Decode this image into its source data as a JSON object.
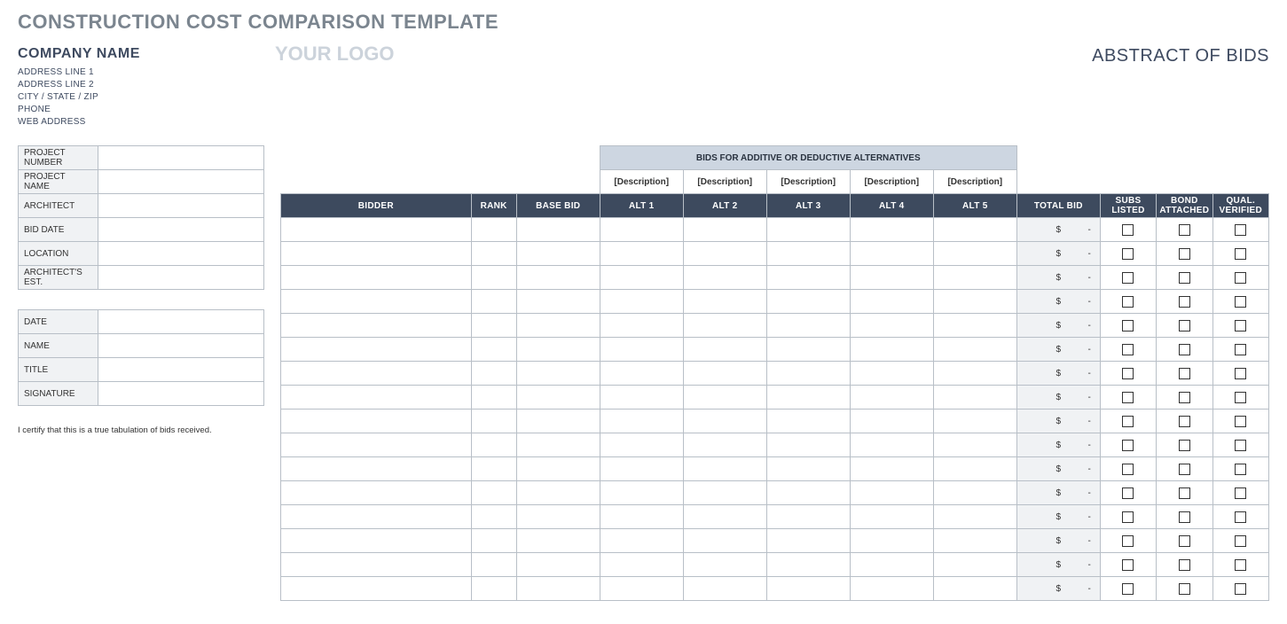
{
  "title": "CONSTRUCTION COST COMPARISON TEMPLATE",
  "company": {
    "name": "COMPANY NAME",
    "addr1": "ADDRESS LINE 1",
    "addr2": "ADDRESS LINE 2",
    "csz": "CITY / STATE / ZIP",
    "phone": "PHONE",
    "web": "WEB ADDRESS"
  },
  "logo": "YOUR LOGO",
  "abstract": "ABSTRACT OF BIDS",
  "infoLabels": [
    "PROJECT NUMBER",
    "PROJECT NAME",
    "ARCHITECT",
    "BID DATE",
    "LOCATION",
    "ARCHITECT'S EST."
  ],
  "sigLabels": [
    "DATE",
    "NAME",
    "TITLE",
    "SIGNATURE"
  ],
  "cert": "I certify that this is a true tabulation of bids received.",
  "altHeader": "BIDS FOR ADDITIVE OR DEDUCTIVE ALTERNATIVES",
  "desc": "[Description]",
  "cols": {
    "bidder": "BIDDER",
    "rank": "RANK",
    "base": "BASE BID",
    "alt1": "ALT 1",
    "alt2": "ALT 2",
    "alt3": "ALT 3",
    "alt4": "ALT 4",
    "alt5": "ALT 5",
    "total": "TOTAL BID",
    "subs": "SUBS LISTED",
    "bond": "BOND ATTACHED",
    "qual": "QUAL. VERIFIED"
  },
  "totalValue": "$",
  "dash": "-",
  "rowCount": 16
}
